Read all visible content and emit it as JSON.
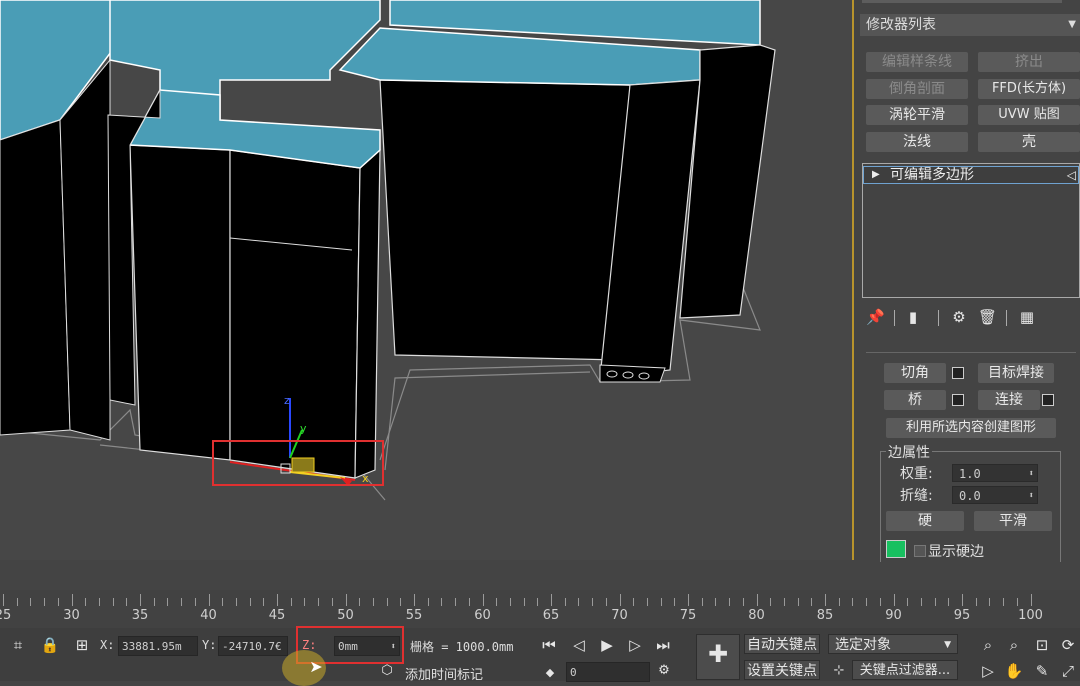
{
  "modifier_panel": {
    "modifier_list_label": "修改器列表",
    "buttons": [
      {
        "label": "编辑样条线",
        "enabled": false
      },
      {
        "label": "挤出",
        "enabled": false
      },
      {
        "label": "倒角剖面",
        "enabled": false
      },
      {
        "label": "FFD(长方体)",
        "enabled": true
      },
      {
        "label": "涡轮平滑",
        "enabled": true
      },
      {
        "label": "UVW 贴图",
        "enabled": true
      },
      {
        "label": "法线",
        "enabled": true
      },
      {
        "label": "壳",
        "enabled": true
      }
    ],
    "stack_item": "可编辑多边形",
    "edit_edges": {
      "chamfer_label": "切角",
      "target_weld_label": "目标焊接",
      "bridge_label": "桥",
      "connect_label": "连接",
      "create_shape_label": "利用所选内容创建图形"
    },
    "edge_properties": {
      "title": "边属性",
      "weight_label": "权重:",
      "weight_value": "1.0",
      "crease_label": "折缝:",
      "crease_value": "0.0",
      "hard_label": "硬",
      "smooth_label": "平滑",
      "show_hard_edges_label": "显示硬边",
      "hard_edge_color": "#18c060"
    }
  },
  "timeline": {
    "ticks": [
      "25",
      "30",
      "35",
      "40",
      "45",
      "50",
      "55",
      "60",
      "65",
      "70",
      "75",
      "80",
      "85",
      "90",
      "95",
      "100"
    ]
  },
  "status_bar": {
    "x_label": "X:",
    "x_value": "33881.95m",
    "y_label": "Y:",
    "y_value": "-24710.7€",
    "z_label": "Z:",
    "z_value": "0mm",
    "grid_text": "栅格 = 1000.0mm",
    "add_time_tag": "添加时间标记",
    "frame_value": "0",
    "auto_key_label": "自动关键点",
    "set_key_label": "设置关键点",
    "selected_object_label": "选定对象",
    "key_filters_label": "关键点过滤器..."
  },
  "gizmo": {
    "x_axis": "x",
    "y_axis": "y",
    "z_axis": "z"
  },
  "colors": {
    "highlight_box": "#e03030",
    "viewport_border": "#b8942c",
    "building_top": "#4a9db6"
  }
}
